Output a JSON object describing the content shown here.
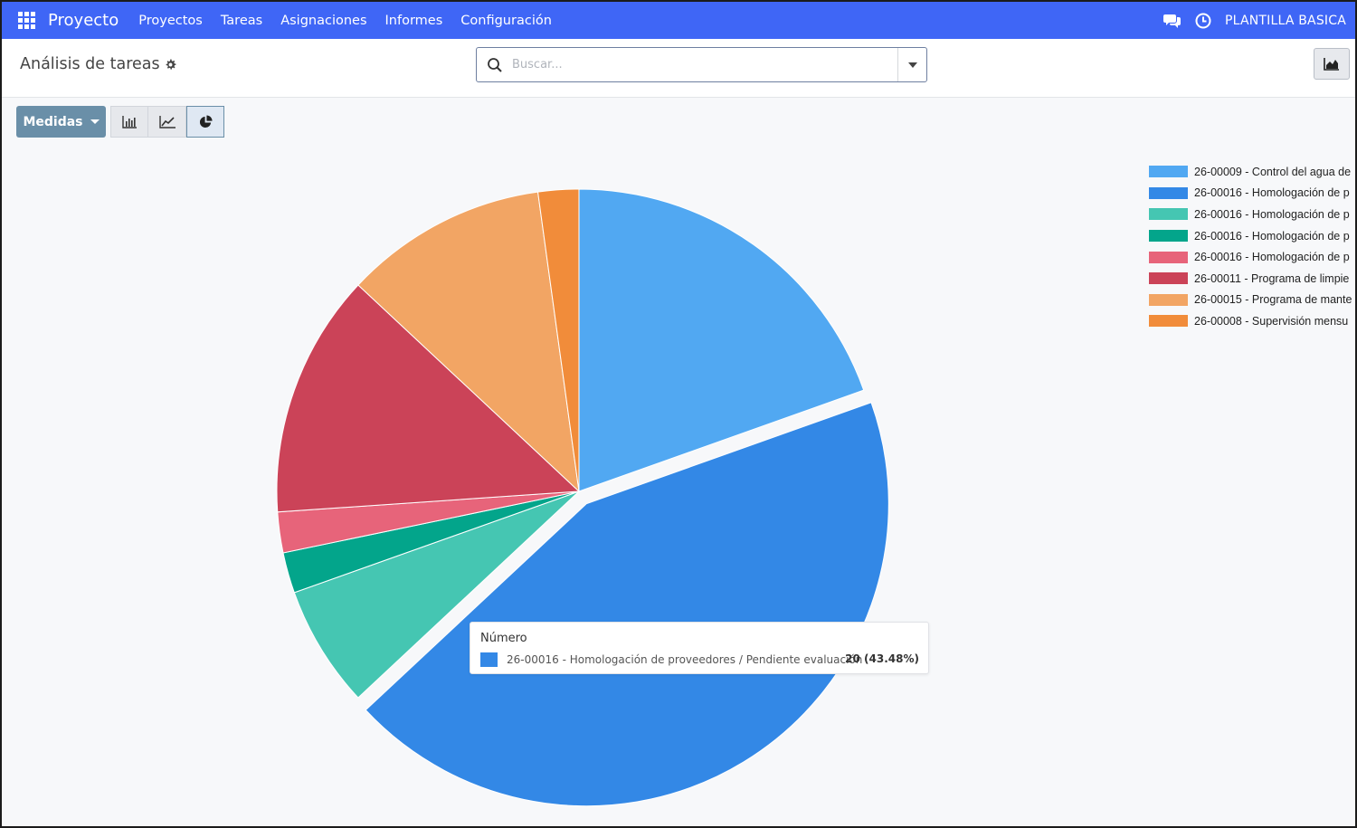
{
  "navbar": {
    "brand": "Proyecto",
    "menu": [
      "Proyectos",
      "Tareas",
      "Asignaciones",
      "Informes",
      "Configuración"
    ],
    "company": "PLANTILLA BASICA",
    "icons": [
      "apps-icon",
      "chat-icon",
      "clock-icon"
    ]
  },
  "control_panel": {
    "title": "Análisis de tareas",
    "search_placeholder": "Buscar...",
    "measures_label": "Medidas"
  },
  "chart_data": {
    "type": "pie",
    "measure": "Número",
    "total": 46,
    "slices": [
      {
        "label": "26-00009 - Control del agua de",
        "value": 9,
        "color": "#51a8f2"
      },
      {
        "label": "26-00016 - Homologación de p",
        "value": 20,
        "color": "#3388e6"
      },
      {
        "label": "26-00016 - Homologación de p",
        "value": 3,
        "color": "#45c6b2"
      },
      {
        "label": "26-00016 - Homologación de p",
        "value": 1,
        "color": "#03a58b"
      },
      {
        "label": "26-00016 - Homologación de p",
        "value": 1,
        "color": "#e7647a"
      },
      {
        "label": "26-00011 - Programa de limpie",
        "value": 6,
        "color": "#cb4358"
      },
      {
        "label": "26-00015 - Programa de mante",
        "value": 5,
        "color": "#f2a564"
      },
      {
        "label": "26-00008 - Supervisión mensu",
        "value": 1,
        "color": "#f18c3a"
      }
    ],
    "highlighted_index": 1,
    "legend_position": "top-right"
  },
  "tooltip": {
    "title": "Número",
    "label": "26-00016 - Homologación de proveedores / Pendiente evaluación",
    "value": "20 (43.48%)",
    "color": "#3388e6"
  }
}
